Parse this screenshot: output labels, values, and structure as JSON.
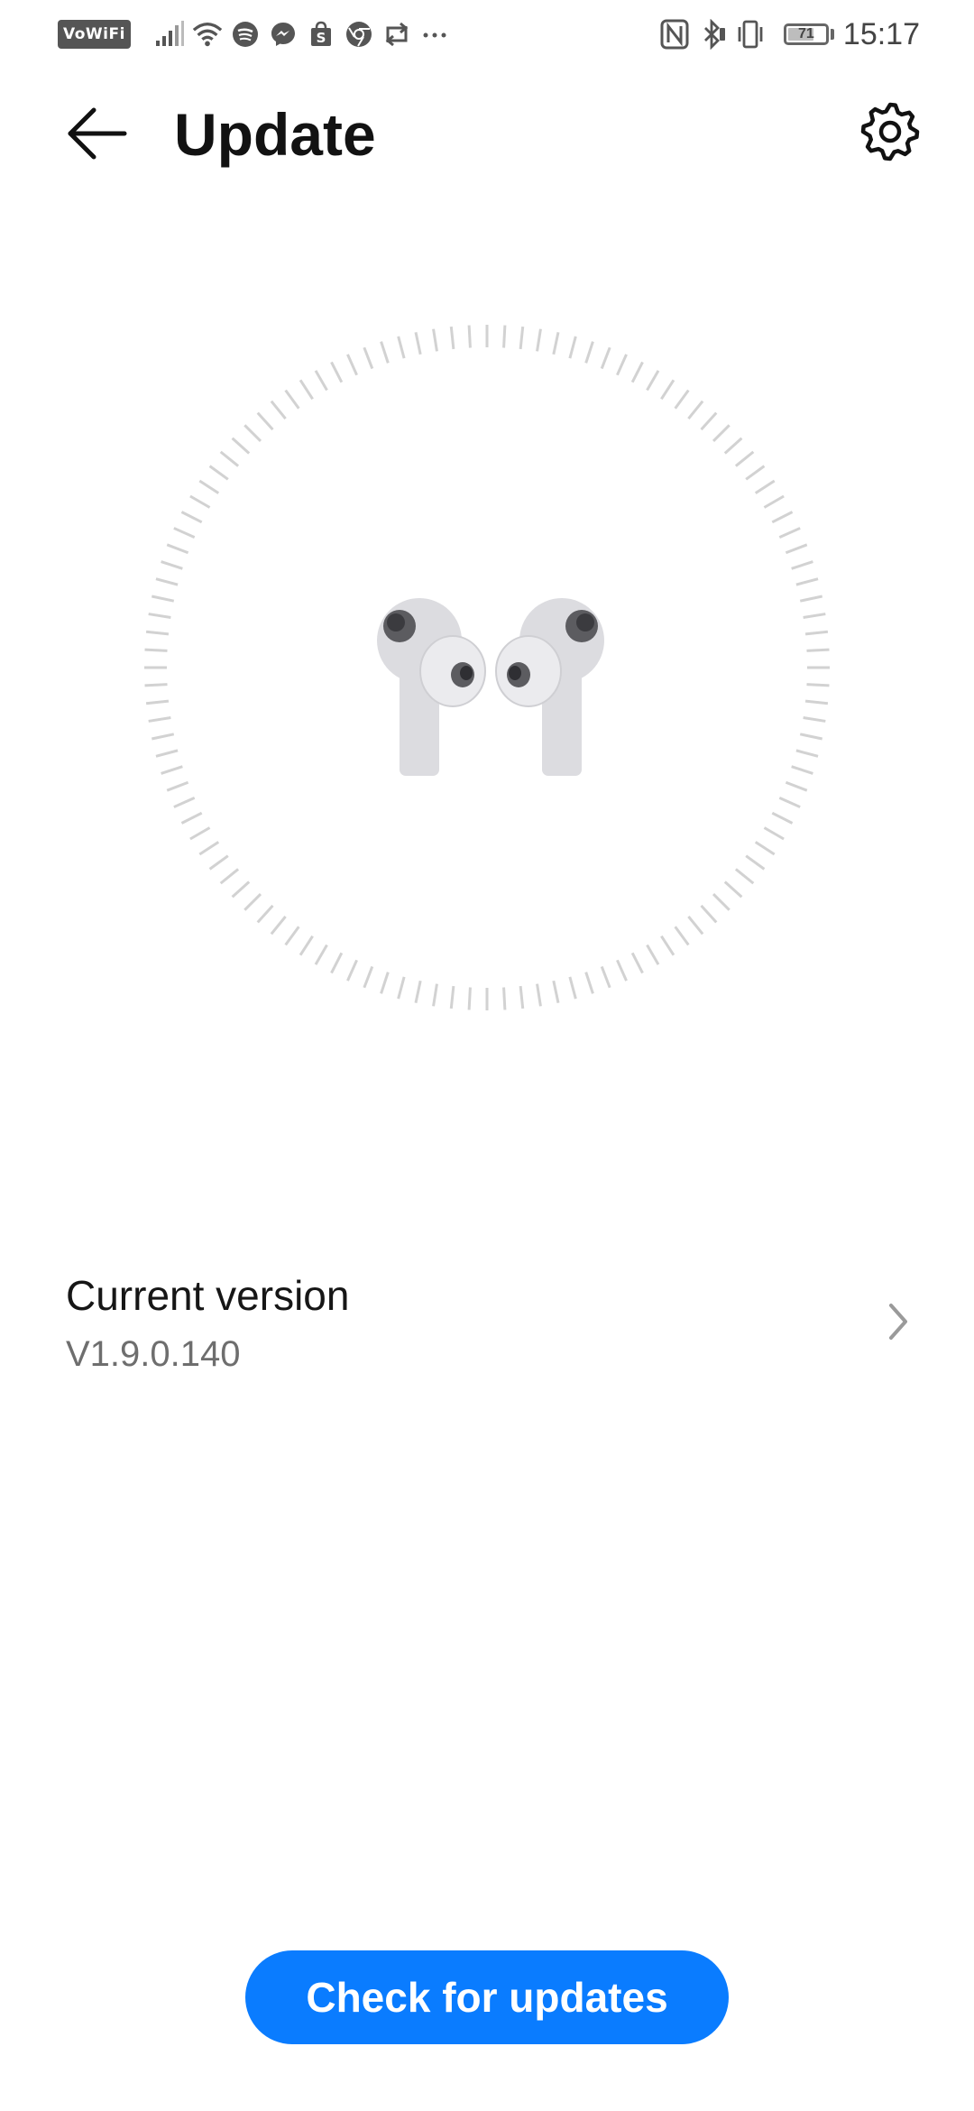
{
  "status_bar": {
    "vowifi_label": "VoWiFi",
    "time": "15:17",
    "battery_level": "71",
    "battery_fraction": 0.71
  },
  "header": {
    "title": "Update",
    "back_icon": "back-arrow-icon",
    "settings_icon": "gear-icon"
  },
  "version": {
    "title": "Current version",
    "value": "V1.9.0.140",
    "chevron_icon": "chevron-right-icon"
  },
  "actions": {
    "check_label": "Check for updates"
  },
  "colors": {
    "accent": "#0a7cff",
    "ring_tick": "#d2d2d2",
    "earbud": "#dcdce0"
  }
}
